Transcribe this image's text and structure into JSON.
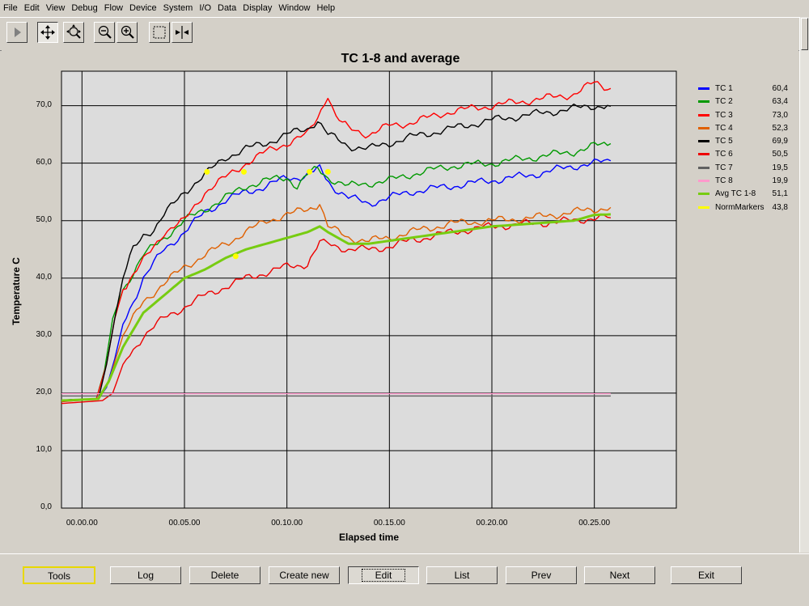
{
  "menu": [
    "File",
    "Edit",
    "View",
    "Debug",
    "Flow",
    "Device",
    "System",
    "I/O",
    "Data",
    "Display",
    "Window",
    "Help"
  ],
  "toolbar": {
    "tools": [
      {
        "icon": "play-icon",
        "state": "normal"
      },
      {
        "icon": "pan-arrows-icon",
        "state": "pressed"
      },
      {
        "icon": "zoom-region-icon",
        "state": "normal"
      },
      {
        "icon": "zoom-out-icon",
        "state": "normal"
      },
      {
        "icon": "zoom-in-icon",
        "state": "normal"
      },
      {
        "icon": "select-rectangle-icon",
        "state": "normal"
      },
      {
        "icon": "cursor-marker-icon",
        "state": "normal"
      }
    ]
  },
  "chart_data": {
    "type": "line",
    "title": "TC 1-8 and average",
    "xlabel": "Elapsed time",
    "ylabel": "Temperature C",
    "x_unit": "minutes",
    "xlim": [
      -1,
      29
    ],
    "ylim": [
      0,
      76
    ],
    "x_ticks": [
      {
        "value": 0,
        "label": "00.00.00"
      },
      {
        "value": 5,
        "label": "00.05.00"
      },
      {
        "value": 10,
        "label": "00.10.00"
      },
      {
        "value": 15,
        "label": "00.15.00"
      },
      {
        "value": 20,
        "label": "00.20.00"
      },
      {
        "value": 25,
        "label": "00.25.00"
      }
    ],
    "y_ticks": [
      {
        "value": 0,
        "label": "0,0"
      },
      {
        "value": 10,
        "label": "10,0"
      },
      {
        "value": 20,
        "label": "20,0"
      },
      {
        "value": 30,
        "label": "30,0"
      },
      {
        "value": 40,
        "label": "40,0"
      },
      {
        "value": 50,
        "label": "50,0"
      },
      {
        "value": 60,
        "label": "60,0"
      },
      {
        "value": 70,
        "label": "70,0"
      }
    ],
    "grid": true,
    "legend_position": "right",
    "series": [
      {
        "name": "TC 1",
        "value": "60,4",
        "color": "#0000ff",
        "width": 1.4,
        "x": [
          -1,
          0.8,
          1.2,
          1.6,
          2,
          3,
          4,
          5,
          6,
          7,
          8,
          9,
          10,
          10.5,
          11,
          11.6,
          12.2,
          13,
          14,
          15,
          16,
          18,
          20,
          22,
          24,
          25,
          25.8
        ],
        "y": [
          18.8,
          19,
          21,
          26,
          32,
          40,
          45,
          48,
          51.5,
          53.5,
          55,
          56,
          57.5,
          57.5,
          58,
          59,
          56,
          54,
          53,
          54,
          55,
          56,
          57,
          58,
          59.5,
          60,
          60.4
        ]
      },
      {
        "name": "TC 2",
        "value": "63,4",
        "color": "#009900",
        "width": 1.4,
        "x": [
          -1,
          0.7,
          1.1,
          1.5,
          2,
          3,
          4,
          5,
          6,
          7,
          8,
          9,
          10,
          10.5,
          11,
          11.5,
          12,
          13,
          14,
          15,
          16,
          18,
          20,
          22,
          24,
          25,
          25.8
        ],
        "y": [
          18.8,
          19,
          24,
          33,
          38,
          44,
          47,
          50,
          52,
          54,
          56,
          57,
          57.5,
          56,
          58,
          59,
          57.5,
          56,
          56.5,
          57,
          58,
          59.5,
          60,
          61,
          62,
          63,
          63.4
        ]
      },
      {
        "name": "TC 3",
        "value": "73,0",
        "color": "#ff0000",
        "width": 1.4,
        "x": [
          -1,
          0.7,
          1.2,
          1.6,
          2,
          3,
          4,
          5,
          6,
          7,
          8,
          9,
          10,
          11,
          11.5,
          12,
          12.4,
          13,
          14,
          15,
          16,
          18,
          20,
          22,
          24,
          25,
          25.8
        ],
        "y": [
          18.5,
          19,
          25,
          33,
          38,
          43,
          48,
          50,
          55,
          57.5,
          60,
          62,
          63.5,
          65,
          68,
          72,
          68,
          66,
          65,
          66.5,
          67,
          69,
          70,
          71,
          72,
          74,
          73
        ]
      },
      {
        "name": "TC 4",
        "value": "52,3",
        "color": "#e06000",
        "width": 1.4,
        "x": [
          -1,
          0.8,
          1.3,
          2,
          3,
          4,
          5,
          6,
          7,
          8,
          9,
          10,
          11,
          11.6,
          12,
          13,
          14,
          15,
          16,
          18,
          20,
          22,
          24,
          25,
          25.8
        ],
        "y": [
          18.6,
          19,
          22,
          30,
          36,
          39,
          42,
          44,
          46,
          48,
          50,
          51,
          52,
          53,
          49,
          47,
          46.5,
          47,
          48,
          49.5,
          50,
          50.5,
          51.5,
          52,
          52.3
        ]
      },
      {
        "name": "TC 5",
        "value": "69,9",
        "color": "#000000",
        "width": 1.4,
        "x": [
          -1,
          0.8,
          1.2,
          1.6,
          2,
          2.5,
          3,
          3.5,
          4,
          5,
          6,
          7,
          8,
          9,
          10,
          11,
          11.5,
          12,
          13,
          14,
          15,
          16,
          18,
          20,
          22,
          24,
          25,
          25.8
        ],
        "y": [
          18.8,
          19,
          25,
          33,
          40,
          45,
          47.5,
          48.5,
          51,
          55,
          58,
          61,
          62.5,
          63.5,
          65,
          66,
          67.5,
          65,
          63,
          62.5,
          63.5,
          64.5,
          66,
          67.5,
          68.5,
          69.5,
          70,
          69.9
        ]
      },
      {
        "name": "TC 6",
        "value": "50,5",
        "color": "#ee0000",
        "width": 1.4,
        "x": [
          -1,
          1,
          1.5,
          2,
          3,
          4,
          5,
          6,
          7,
          8,
          9,
          10,
          11,
          11.6,
          12,
          13,
          14,
          15,
          16,
          18,
          20,
          22,
          24,
          25,
          25.8
        ],
        "y": [
          18.2,
          18.7,
          20,
          25,
          30,
          33,
          35,
          37,
          38.5,
          40,
          41,
          42,
          42.5,
          46,
          46,
          45,
          45,
          45.5,
          46.5,
          48,
          49,
          49.5,
          50,
          50.5,
          50.5
        ]
      },
      {
        "name": "TC 7",
        "value": "19,5",
        "color": "#606060",
        "width": 1.4,
        "x": [
          -1,
          25.8
        ],
        "y": [
          19.5,
          19.5
        ]
      },
      {
        "name": "TC 8",
        "value": "19,9",
        "color": "#ff99cc",
        "width": 1.4,
        "x": [
          -1,
          25.8
        ],
        "y": [
          19.9,
          19.9
        ]
      },
      {
        "name": "Avg TC 1-8",
        "value": "51,1",
        "color": "#77cc11",
        "width": 3,
        "x": [
          -1,
          0.8,
          1.3,
          2,
          3,
          4,
          5,
          6,
          7,
          8,
          9,
          10,
          11,
          11.6,
          12,
          13,
          14,
          15,
          16,
          18,
          20,
          22,
          24,
          25,
          25.8
        ],
        "y": [
          18.7,
          19,
          22,
          28,
          34,
          37,
          40,
          41.5,
          43.5,
          45,
          46,
          47,
          48,
          49,
          48,
          46,
          46,
          46.5,
          47,
          48,
          49,
          49.5,
          50,
          51,
          51.1
        ]
      },
      {
        "name": "NormMarkers",
        "value": "43,8",
        "color": "#ffff00",
        "width": 0,
        "marker": true,
        "x": [
          6.1,
          7.9,
          7.5,
          11.1,
          12
        ],
        "y": [
          58.5,
          58.5,
          43.8,
          58.5,
          58.5
        ]
      }
    ]
  },
  "bottom_buttons": [
    "Tools",
    "Log",
    "Delete",
    "Create new",
    "Edit",
    "List",
    "Prev",
    "Next",
    "Exit"
  ]
}
